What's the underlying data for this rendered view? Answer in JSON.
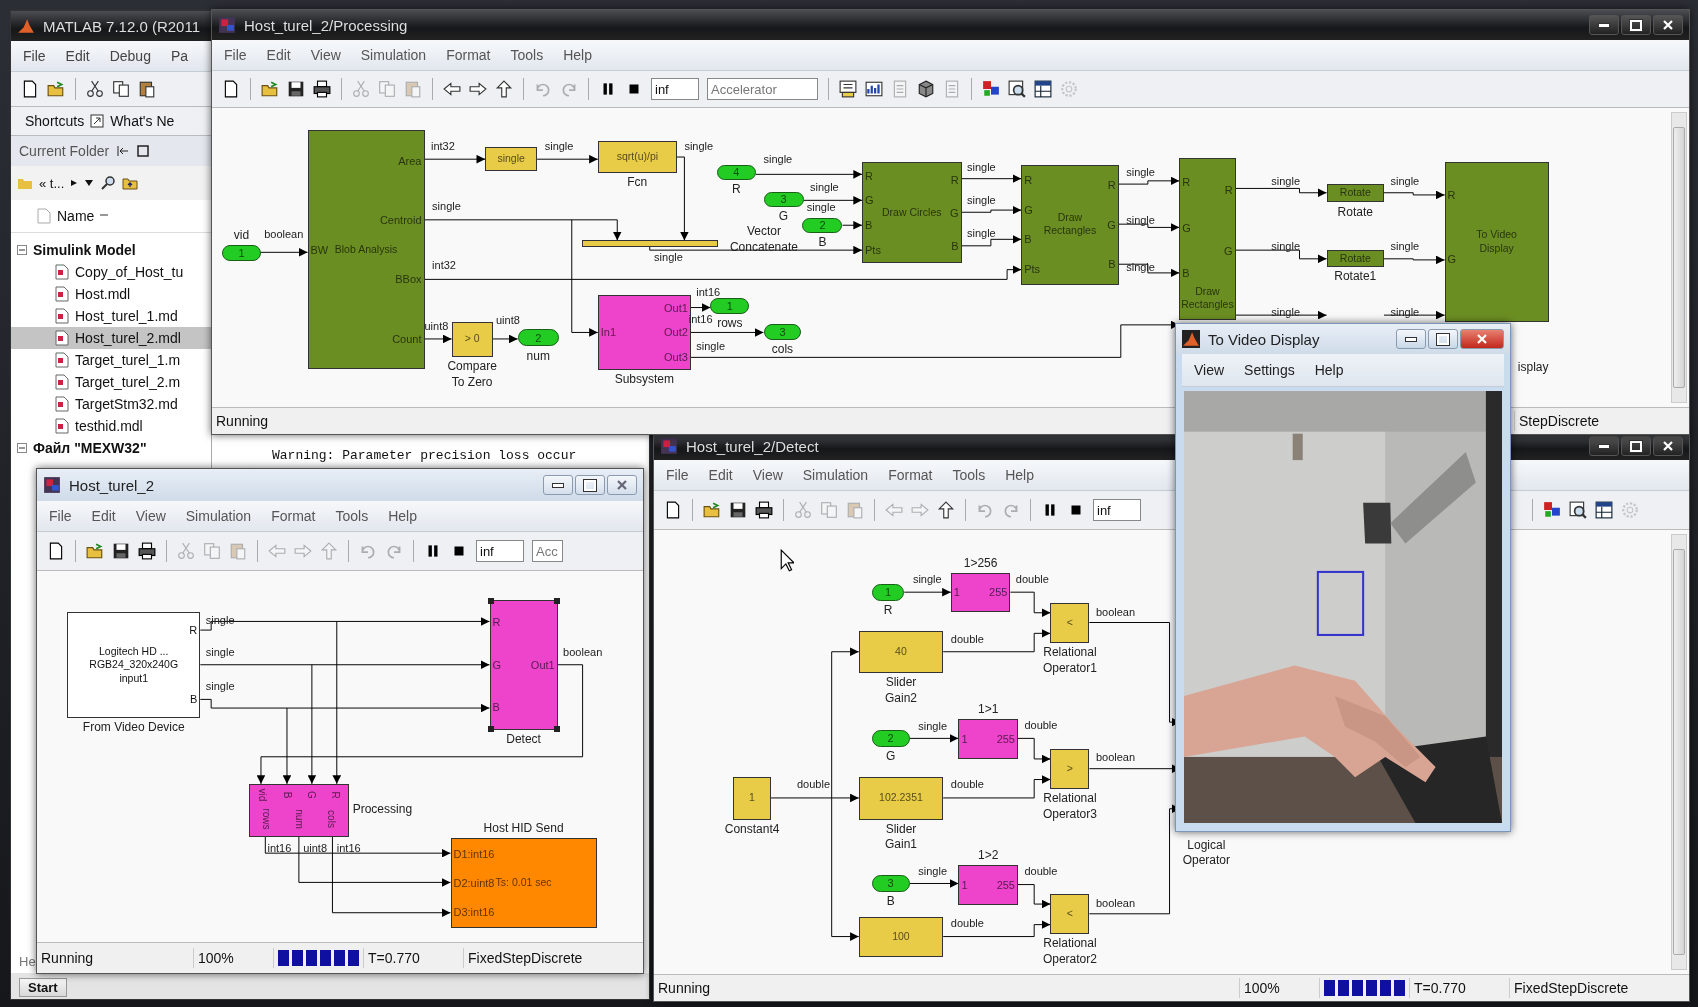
{
  "matlab_window": {
    "title": "MATLAB 7.12.0 (R2011",
    "menu": [
      "File",
      "Edit",
      "Debug",
      "Pa"
    ],
    "toolbar": [
      {
        "kind": "new",
        "disabled": false
      },
      {
        "kind": "open",
        "disabled": false
      },
      {
        "kind": "separator"
      },
      {
        "kind": "cut",
        "disabled": false
      },
      {
        "kind": "copy",
        "disabled": false
      },
      {
        "kind": "paste",
        "disabled": false
      }
    ],
    "shortcuts": [
      "Shortcuts",
      "What's Ne"
    ],
    "current_folder": {
      "title": "Current Folder",
      "path": "« t...",
      "column": "Name",
      "tree": [
        {
          "label": "Simulink Model",
          "expanded": true,
          "children": [
            {
              "label": "Copy_of_Host_tu",
              "selected": false
            },
            {
              "label": "Host.mdl",
              "selected": false
            },
            {
              "label": "Host_turel_1.md",
              "selected": false
            },
            {
              "label": "Host_turel_2.mdl",
              "selected": true
            },
            {
              "label": "Target_turel_1.m",
              "selected": false
            },
            {
              "label": "Target_turel_2.m",
              "selected": false
            },
            {
              "label": "TargetStm32.md",
              "selected": false
            },
            {
              "label": "testhid.mdl",
              "selected": false
            }
          ]
        },
        {
          "label": "Файл \"MEXW32\"",
          "expanded": true
        }
      ]
    },
    "command_window": [
      "Warning: Parameter precision loss occur"
    ],
    "panel_label": "He",
    "start_button": "Start"
  },
  "processing_window": {
    "title": "Host_turel_2/Processing",
    "menu": [
      "File",
      "Edit",
      "View",
      "Simulation",
      "Format",
      "Tools",
      "Help"
    ],
    "toolbar": {
      "buttons": [
        {
          "kind": "new",
          "disabled": false
        },
        {
          "kind": "separator"
        },
        {
          "kind": "open",
          "disabled": false
        },
        {
          "kind": "save",
          "disabled": false
        },
        {
          "kind": "print",
          "disabled": false
        },
        {
          "kind": "separator"
        },
        {
          "kind": "cut",
          "disabled": true
        },
        {
          "kind": "copy",
          "disabled": true
        },
        {
          "kind": "paste",
          "disabled": true
        },
        {
          "kind": "separator"
        },
        {
          "kind": "back",
          "disabled": false
        },
        {
          "kind": "forward",
          "disabled": false
        },
        {
          "kind": "up",
          "disabled": false
        },
        {
          "kind": "separator"
        },
        {
          "kind": "undo",
          "disabled": true
        },
        {
          "kind": "redo",
          "disabled": true
        },
        {
          "kind": "separator"
        },
        {
          "kind": "pause",
          "disabled": false
        },
        {
          "kind": "stop",
          "disabled": false
        }
      ],
      "stop_time": "inf",
      "mode": "Accelerator",
      "more_buttons": [
        {
          "kind": "build",
          "disabled": false
        },
        {
          "kind": "chart",
          "disabled": false
        },
        {
          "kind": "doc",
          "disabled": true
        },
        {
          "kind": "cube",
          "disabled": false
        },
        {
          "kind": "doc",
          "disabled": true
        },
        {
          "kind": "separator"
        },
        {
          "kind": "blocks",
          "disabled": false
        },
        {
          "kind": "magnifier",
          "disabled": false
        },
        {
          "kind": "grid",
          "disabled": false
        },
        {
          "kind": "gear",
          "disabled": true
        }
      ]
    },
    "diagram": {
      "blocks": [
        {
          "kind": "port",
          "color": "#22cc22",
          "text": "1",
          "caption": "vid"
        },
        {
          "kind": "block",
          "color": "#6b8e23",
          "text": "Blob Analysis",
          "in": [
            "BW"
          ],
          "out": [
            "Area",
            "Centroid",
            "BBox",
            "Count"
          ]
        },
        {
          "kind": "block",
          "color": "#e8cc48",
          "text": "single"
        },
        {
          "kind": "block",
          "color": "#e8cc48",
          "text": "sqrt(u)/pi",
          "caption": "Fcn"
        },
        {
          "kind": "port",
          "color": "#22cc22",
          "text": "4",
          "caption": "R"
        },
        {
          "kind": "port",
          "color": "#22cc22",
          "text": "3",
          "caption": "G"
        },
        {
          "kind": "bar",
          "color": "#e8cc48",
          "caption": "Vector Concatenate"
        },
        {
          "kind": "port",
          "color": "#22cc22",
          "text": "2",
          "caption": "B"
        },
        {
          "kind": "block",
          "color": "#6b8e23",
          "text": "Draw Circles",
          "in": [
            "R",
            "G",
            "B",
            "Pts"
          ],
          "out": [
            "R",
            "G",
            "B"
          ]
        },
        {
          "kind": "block",
          "color": "#6b8e23",
          "text": "Draw Rectangles",
          "in": [
            "R",
            "G",
            "B",
            "Pts"
          ],
          "out": [
            "R",
            "G",
            "B"
          ]
        },
        {
          "kind": "block",
          "color": "#6b8e23",
          "text": "Draw Rectangles",
          "in": [
            "R",
            "G",
            "B"
          ],
          "out": [
            "R",
            "G"
          ]
        },
        {
          "kind": "block",
          "color": "#6b8e23",
          "text": "Rotate",
          "caption": "Rotate"
        },
        {
          "kind": "block",
          "color": "#6b8e23",
          "text": "Rotate",
          "caption": "Rotate1"
        },
        {
          "kind": "block",
          "color": "#e8cc48",
          "text": "> 0",
          "caption": "Compare To Zero"
        },
        {
          "kind": "port",
          "color": "#22cc22",
          "text": "2",
          "caption": "num"
        },
        {
          "kind": "block",
          "color": "#ee44cc",
          "in": [
            "In1"
          ],
          "out": [
            "Out1",
            "Out2",
            "Out3"
          ],
          "caption": "Subsystem"
        },
        {
          "kind": "port",
          "color": "#22cc22",
          "text": "1",
          "caption": "rows"
        },
        {
          "kind": "port",
          "color": "#22cc22",
          "text": "3",
          "caption": "cols"
        },
        {
          "kind": "block",
          "color": "#6b8e23",
          "text": "To Video Display",
          "in": [
            "R",
            "G"
          ],
          "caption": "isplay"
        }
      ],
      "signal_labels": [
        "int32",
        "single",
        "single",
        "single",
        "boolean",
        "int32",
        "single",
        "uint8",
        "uint8",
        "int16",
        "int16",
        "single",
        "single",
        "single",
        "single",
        "single",
        "single",
        "single",
        "single",
        "single",
        "single",
        "single",
        "single",
        "single",
        "single",
        "single",
        "single"
      ]
    },
    "status": {
      "state": "Running",
      "solver": "StepDiscrete"
    }
  },
  "host_window": {
    "title": "Host_turel_2",
    "menu": [
      "File",
      "Edit",
      "View",
      "Simulation",
      "Format",
      "Tools",
      "Help"
    ],
    "toolbar": {
      "buttons": [
        {
          "kind": "new",
          "disabled": false
        },
        {
          "kind": "separator"
        },
        {
          "kind": "open",
          "disabled": false
        },
        {
          "kind": "save",
          "disabled": false
        },
        {
          "kind": "print",
          "disabled": false
        },
        {
          "kind": "separator"
        },
        {
          "kind": "cut",
          "disabled": true
        },
        {
          "kind": "copy",
          "disabled": true
        },
        {
          "kind": "paste",
          "disabled": true
        },
        {
          "kind": "separator"
        },
        {
          "kind": "back",
          "disabled": true
        },
        {
          "kind": "forward",
          "disabled": true
        },
        {
          "kind": "up",
          "disabled": true
        },
        {
          "kind": "separator"
        },
        {
          "kind": "undo",
          "disabled": true
        },
        {
          "kind": "redo",
          "disabled": true
        },
        {
          "kind": "separator"
        },
        {
          "kind": "pause",
          "disabled": false
        },
        {
          "kind": "stop",
          "disabled": false
        }
      ],
      "stop_time": "inf",
      "mode": "Acc"
    },
    "diagram": {
      "blocks": [
        {
          "kind": "block",
          "color": "#ffffff",
          "text": "Logitech HD ...\nRGB24_320x240G\ninput1",
          "out": [
            "R",
            "B"
          ],
          "caption": "From Video Device",
          "selected": false
        },
        {
          "kind": "block",
          "color": "#ee44cc",
          "in": [
            "R",
            "G",
            "B"
          ],
          "out": [
            "Out1"
          ],
          "caption": "Detect",
          "selected": true
        },
        {
          "kind": "block",
          "color": "#ee44cc",
          "in": [
            "vid",
            "B",
            "G",
            "R"
          ],
          "out": [
            "rows",
            "num",
            "cols"
          ],
          "caption": "Processing",
          "selected": false
        },
        {
          "kind": "block",
          "color": "#ff8800",
          "text": "Ts: 0.01 sec",
          "in": [
            "D1:int16",
            "D2:uint8",
            "D3:int16"
          ],
          "caption": "Host HID Send",
          "selected": false
        }
      ],
      "signal_labels": [
        "single",
        "single",
        "single",
        "boolean",
        "int16",
        "uint8",
        "int16"
      ]
    },
    "status": {
      "state": "Running",
      "zoom": "100%",
      "progress": {
        "level": 1
      },
      "time": "T=0.770",
      "solver": "FixedStepDiscrete"
    }
  },
  "detect_window": {
    "title": "Host_turel_2/Detect",
    "menu": [
      "File",
      "Edit",
      "View",
      "Simulation",
      "Format",
      "Tools",
      "Help"
    ],
    "toolbar": {
      "buttons": [
        {
          "kind": "new",
          "disabled": false
        },
        {
          "kind": "separator"
        },
        {
          "kind": "open",
          "disabled": false
        },
        {
          "kind": "save",
          "disabled": false
        },
        {
          "kind": "print",
          "disabled": false
        },
        {
          "kind": "separator"
        },
        {
          "kind": "cut",
          "disabled": true
        },
        {
          "kind": "copy",
          "disabled": true
        },
        {
          "kind": "paste",
          "disabled": true
        },
        {
          "kind": "separator"
        },
        {
          "kind": "back",
          "disabled": true
        },
        {
          "kind": "forward",
          "disabled": true
        },
        {
          "kind": "up",
          "disabled": false
        },
        {
          "kind": "separator"
        },
        {
          "kind": "undo",
          "disabled": true
        },
        {
          "kind": "redo",
          "disabled": true
        },
        {
          "kind": "separator"
        },
        {
          "kind": "pause",
          "disabled": false
        },
        {
          "kind": "stop",
          "disabled": false
        }
      ],
      "stop_time": "inf",
      "more_buttons": [
        {
          "kind": "blocks",
          "disabled": false
        },
        {
          "kind": "magnifier",
          "disabled": false
        },
        {
          "kind": "grid",
          "disabled": false
        },
        {
          "kind": "gear",
          "disabled": true
        }
      ]
    },
    "diagram": {
      "blocks": [
        {
          "kind": "port",
          "color": "#22cc22",
          "text": "1",
          "caption": "R"
        },
        {
          "kind": "block",
          "color": "#ee44cc",
          "in": [
            "1"
          ],
          "out": [
            "255"
          ],
          "caption": "1>256"
        },
        {
          "kind": "block",
          "color": "#e8cc48",
          "text": "40",
          "caption": "Slider Gain2"
        },
        {
          "kind": "block",
          "color": "#e8cc48",
          "text": "<",
          "caption": "Relational Operator1"
        },
        {
          "kind": "port",
          "color": "#22cc22",
          "text": "2",
          "caption": "G"
        },
        {
          "kind": "block",
          "color": "#ee44cc",
          "in": [
            "1"
          ],
          "out": [
            "255"
          ],
          "caption": "1>1"
        },
        {
          "kind": "block",
          "color": "#e8cc48",
          "text": "1",
          "caption": "Constant4"
        },
        {
          "kind": "block",
          "color": "#e8cc48",
          "text": "102.2351",
          "caption": "Slider Gain1"
        },
        {
          "kind": "block",
          "color": "#e8cc48",
          "text": ">",
          "caption": "Relational Operator3"
        },
        {
          "kind": "caption",
          "caption": "Logical Operator"
        },
        {
          "kind": "port",
          "color": "#22cc22",
          "text": "3",
          "caption": "B"
        },
        {
          "kind": "block",
          "color": "#ee44cc",
          "in": [
            "1"
          ],
          "out": [
            "255"
          ],
          "caption": "1>2"
        },
        {
          "kind": "block",
          "color": "#e8cc48",
          "text": "100"
        },
        {
          "kind": "block",
          "color": "#e8cc48",
          "text": "<",
          "caption": "Relational Operator2"
        }
      ],
      "signal_labels": [
        "single",
        "double",
        "double",
        "boolean",
        "single",
        "double",
        "boolean",
        "double",
        "double",
        "single",
        "double",
        "boolean",
        "double"
      ]
    },
    "status": {
      "state": "Running",
      "zoom": "100%",
      "progress": {
        "level": 1
      },
      "time": "T=0.770",
      "solver": "FixedStepDiscrete"
    }
  },
  "video_window": {
    "title": "To Video Display",
    "menu": [
      "View",
      "Settings",
      "Help"
    ]
  }
}
